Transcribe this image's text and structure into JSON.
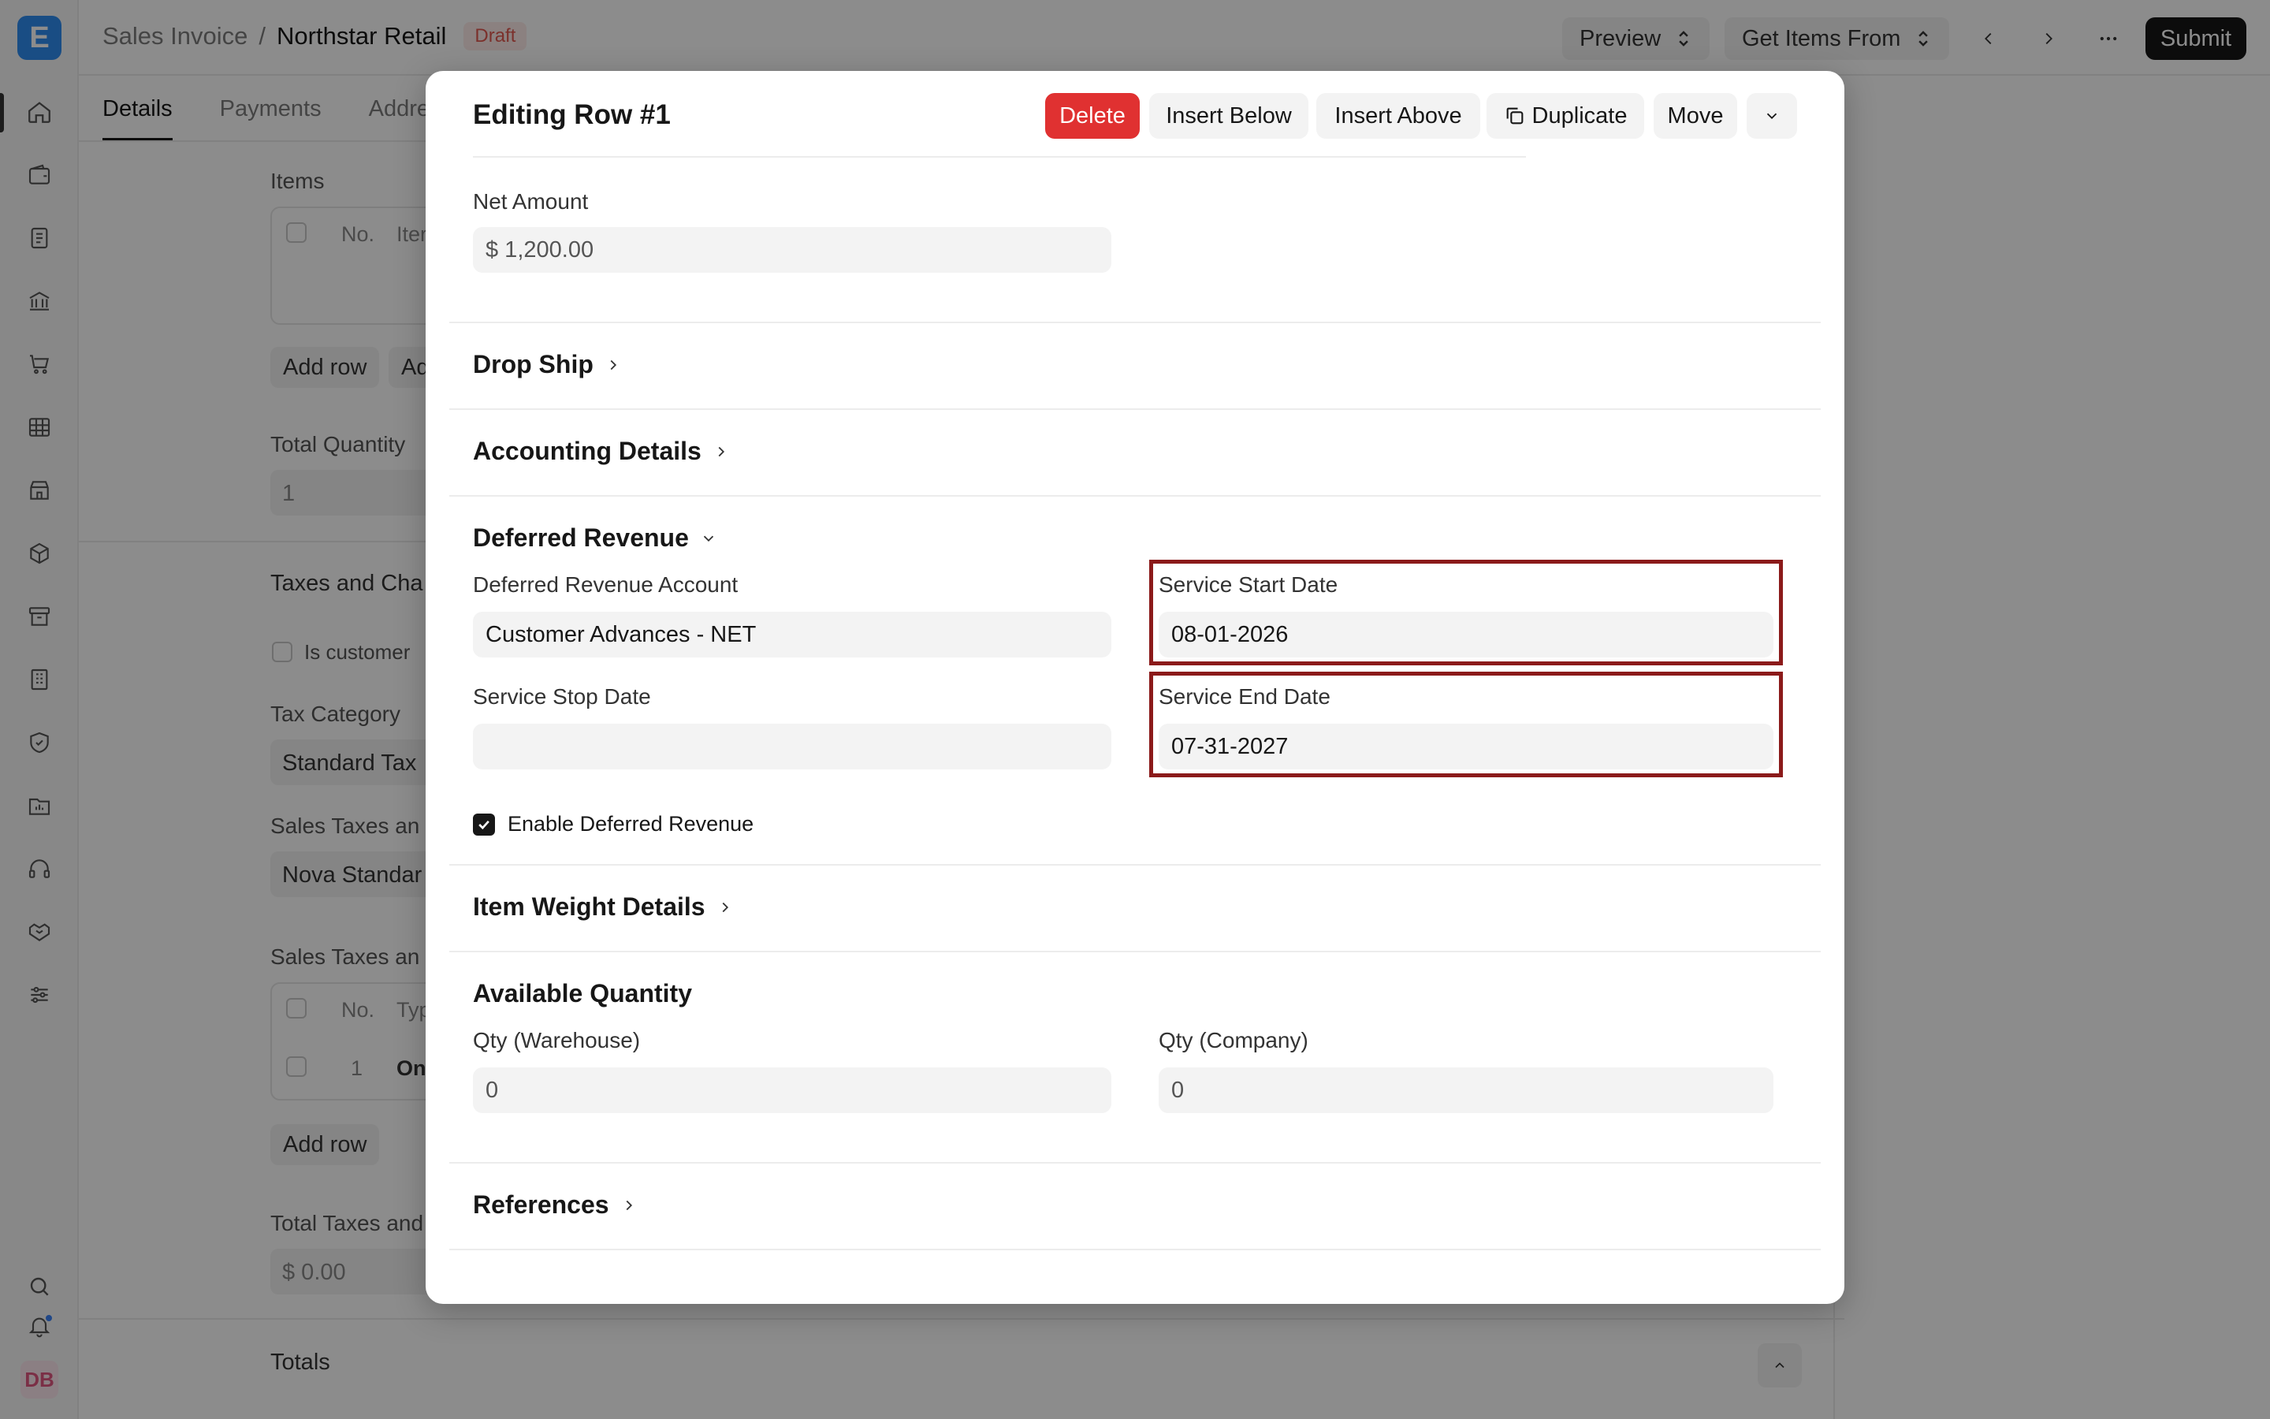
{
  "app": {
    "logo_letter": "E",
    "avatar_initials": "DB",
    "breadcrumb": {
      "parent": "Sales Invoice",
      "separator": "/",
      "current": "Northstar Retail",
      "status": "Draft"
    },
    "toolbar": {
      "preview": "Preview",
      "get_items_from": "Get Items From",
      "submit": "Submit"
    },
    "tabs": [
      "Details",
      "Payments",
      "Addre"
    ],
    "sidebar_icons": [
      "home-icon",
      "wallet-icon",
      "document-icon",
      "bank-icon",
      "cart-icon",
      "table-icon",
      "store-icon",
      "package-icon",
      "archive-icon",
      "building-icon",
      "shield-icon",
      "folder-chart-icon",
      "headset-icon",
      "handshake-icon",
      "sliders-icon",
      "search-icon",
      "bell-icon"
    ],
    "form": {
      "items_label": "Items",
      "items_table_cols": [
        "No.",
        "Iter"
      ],
      "add_row": "Add row",
      "add_multiple": "Ad",
      "total_quantity_label": "Total Quantity",
      "total_quantity_value": "1",
      "taxes_section": "Taxes and Cha",
      "is_customer_label": "Is customer",
      "tax_category_label": "Tax Category",
      "tax_category_value": "Standard Tax",
      "sales_taxes_template_label": "Sales Taxes an",
      "sales_taxes_template_value": "Nova Standar",
      "sales_taxes_table_label": "Sales Taxes an",
      "taxes_table_cols": [
        "No.",
        "Typ"
      ],
      "taxes_row": {
        "no": "1",
        "type": "On"
      },
      "add_row_2": "Add row",
      "total_taxes_label": "Total Taxes and",
      "total_taxes_value": "$ 0.00",
      "totals_section": "Totals"
    }
  },
  "modal": {
    "title": "Editing Row #1",
    "actions": {
      "delete": "Delete",
      "insert_below": "Insert Below",
      "insert_above": "Insert Above",
      "duplicate": "Duplicate",
      "move": "Move"
    },
    "net_amount": {
      "label": "Net Amount",
      "value": "$ 1,200.00"
    },
    "sections": {
      "drop_ship": "Drop Ship",
      "accounting_details": "Accounting Details",
      "deferred_revenue": "Deferred Revenue",
      "item_weight_details": "Item Weight Details",
      "available_quantity": "Available Quantity",
      "references": "References"
    },
    "deferred": {
      "account_label": "Deferred Revenue Account",
      "account_value": "Customer Advances - NET",
      "start_label": "Service Start Date",
      "start_value": "08-01-2026",
      "stop_label": "Service Stop Date",
      "stop_value": "",
      "end_label": "Service End Date",
      "end_value": "07-31-2027",
      "enable_label": "Enable Deferred Revenue",
      "enable_checked": true
    },
    "quantity": {
      "warehouse_label": "Qty (Warehouse)",
      "warehouse_value": "0",
      "company_label": "Qty (Company)",
      "company_value": "0"
    }
  }
}
